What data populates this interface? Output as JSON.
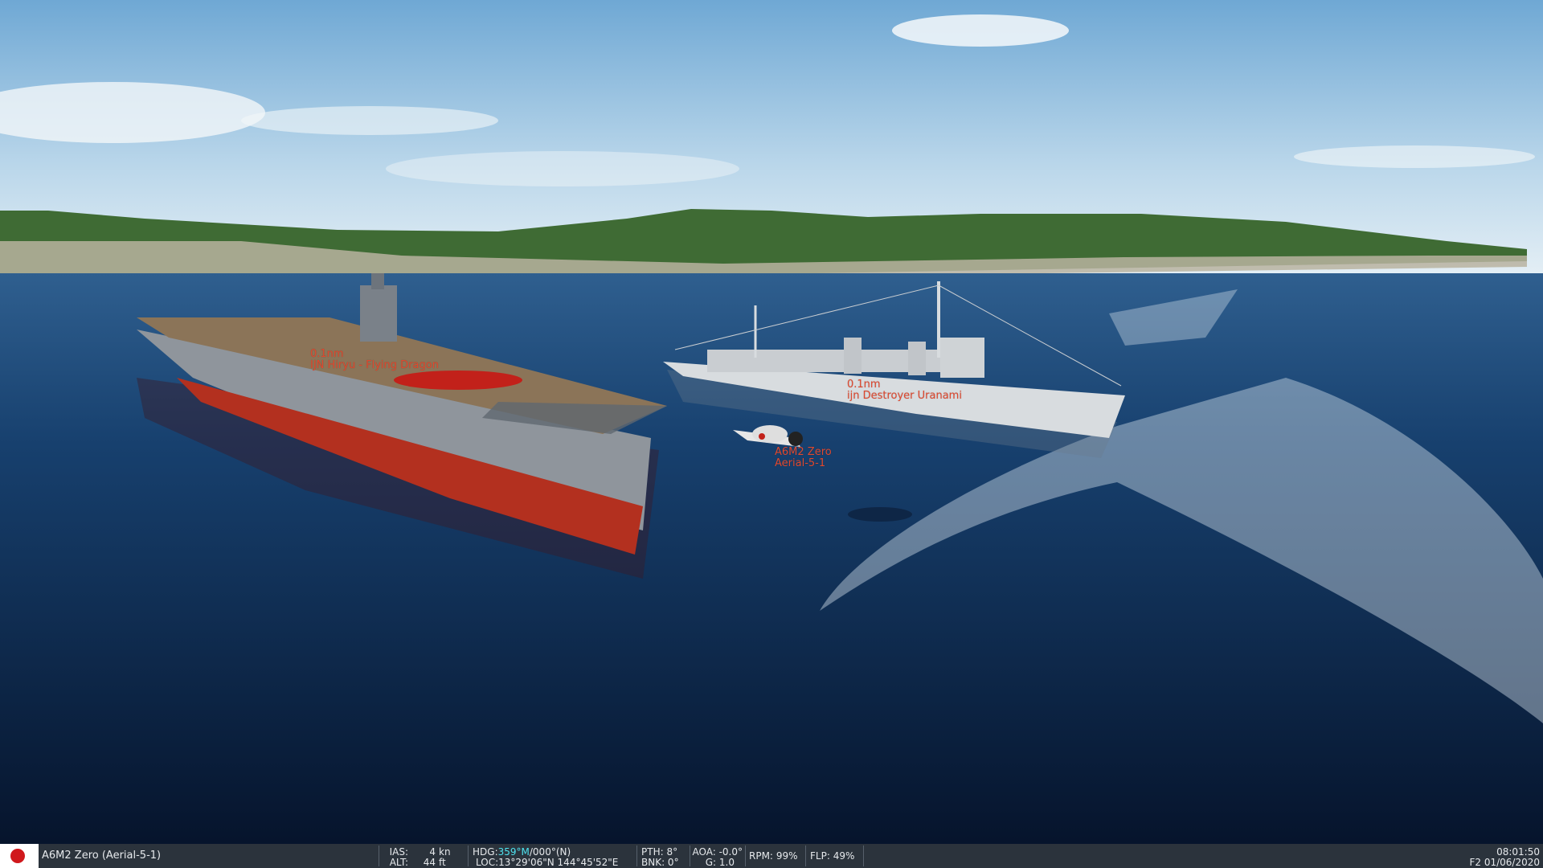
{
  "labels": {
    "carrier": {
      "distance": "0.1nm",
      "name": "IJN Hiryu - Flying Dragon"
    },
    "destroyer": {
      "distance": "0.1nm",
      "name": "ijn Destroyer Uranami"
    },
    "aircraft": {
      "line1": "A6M2 Zero",
      "line2": "Aerial-5-1"
    }
  },
  "hud": {
    "aircraft_name": "A6M2 Zero (Aerial-5-1)",
    "ias_label": "IAS:",
    "ias_value": "4",
    "ias_unit": "kn",
    "alt_label": "ALT:",
    "alt_value": "44",
    "alt_unit": "ft",
    "hdg_label": "HDG:",
    "hdg_mag": "359°M",
    "hdg_true": "/000°(N)",
    "loc_label": "LOC:",
    "loc_value": "13°29'06\"N 144°45'52\"E",
    "pth": "PTH: 8°",
    "bnk": "BNK: 0°",
    "aoa": "AOA: -0.0°",
    "g": "G: 1.0",
    "rpm_label": "RPM:",
    "rpm_value": "99%",
    "flp_label": "FLP:",
    "flp_value": "49%",
    "time": "08:01:50",
    "date": "F2 01/06/2020"
  },
  "colors": {
    "label": "#e0492f",
    "hud_bg": "#2b333c",
    "hdg_accent": "#4fe3f0"
  }
}
